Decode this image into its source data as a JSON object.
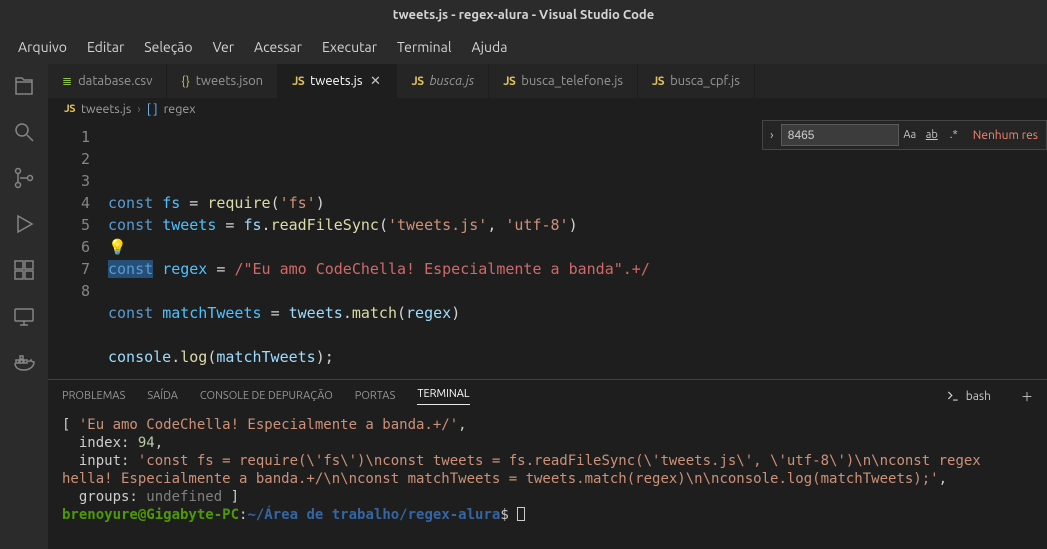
{
  "window": {
    "title": "tweets.js - regex-alura - Visual Studio Code"
  },
  "menu": {
    "items": [
      "Arquivo",
      "Editar",
      "Seleção",
      "Ver",
      "Acessar",
      "Executar",
      "Terminal",
      "Ajuda"
    ]
  },
  "tabs": [
    {
      "icon": "csv",
      "label": "database.csv",
      "active": false,
      "dim": false,
      "closable": false
    },
    {
      "icon": "json",
      "label": "tweets.json",
      "active": false,
      "dim": false,
      "closable": false
    },
    {
      "icon": "js",
      "label": "tweets.js",
      "active": true,
      "dim": false,
      "closable": true
    },
    {
      "icon": "js",
      "label": "busca.js",
      "active": false,
      "dim": true,
      "closable": false
    },
    {
      "icon": "js",
      "label": "busca_telefone.js",
      "active": false,
      "dim": false,
      "closable": false
    },
    {
      "icon": "js",
      "label": "busca_cpf.js",
      "active": false,
      "dim": false,
      "closable": false
    }
  ],
  "breadcrumb": {
    "icon": "js",
    "file": "tweets.js",
    "symbol_icon": "[ ]",
    "symbol": "regex"
  },
  "find": {
    "value": "8465",
    "no_results": "Nenhum res",
    "case_label": "Aa",
    "word_label": "ab",
    "regex_label": ".*"
  },
  "code": {
    "lines": [
      {
        "n": "1",
        "html": "<span class='kw'>const</span> <span class='vr2'>fs</span> <span class='op'>=</span> <span class='fn'>require</span>(<span class='str'>'fs'</span>)"
      },
      {
        "n": "2",
        "html": "<span class='kw'>const</span> <span class='vr2'>tweets</span> <span class='op'>=</span> <span class='vr'>fs</span>.<span class='fn'>readFileSync</span>(<span class='str'>'tweets.js'</span>, <span class='str'>'utf-8'</span>)"
      },
      {
        "n": "3",
        "html": "<span class='bulb'>💡</span>"
      },
      {
        "n": "4",
        "html": "<span class='cur-sel'><span class='kw'>const</span></span> <span class='vr2'>regex</span> <span class='op'>=</span> <span class='rgx'>/</span><span class='rgx'>\"Eu amo CodeChella! Especialmente a banda\".+/</span>"
      },
      {
        "n": "5",
        "html": ""
      },
      {
        "n": "6",
        "html": "<span class='kw'>const</span> <span class='vr2'>matchTweets</span> <span class='op'>=</span> <span class='vr'>tweets</span>.<span class='fn'>match</span>(<span class='vr'>regex</span>)"
      },
      {
        "n": "7",
        "html": ""
      },
      {
        "n": "8",
        "html": "<span class='vr'>console</span>.<span class='fn'>log</span>(<span class='vr'>matchTweets</span>);"
      }
    ]
  },
  "panel": {
    "tabs": {
      "problemas": "PROBLEMAS",
      "saida": "SAÍDA",
      "depuracao": "CONSOLE DE DEPURAÇÃO",
      "portas": "PORTAS",
      "terminal": "TERMINAL"
    },
    "shell": "bash",
    "terminal_html": "[ <span class='to-str'>'Eu amo CodeChella! Especialmente a banda.+/'</span>,\n  index: <span class='to-num'>94</span>,\n  input: <span class='to-str'>'const fs = require(\\'fs\\')\\nconst tweets = fs.readFileSync(\\'tweets.js\\', \\'utf-8\\')\\n\\nconst regex</span>\n<span class='to-str'>hella! Especialmente a banda.+/\\n\\nconst matchTweets = tweets.match(regex)\\n\\nconsole.log(matchTweets);'</span>,\n  groups: <span class='to-undef'>undefined</span> ]\n<span class='to-user'>brenoyure@Gigabyte-PC</span>:<span class='to-path'>~/Área de trabalho/regex-alura</span>$ <span class='to-cursor'></span>"
  }
}
